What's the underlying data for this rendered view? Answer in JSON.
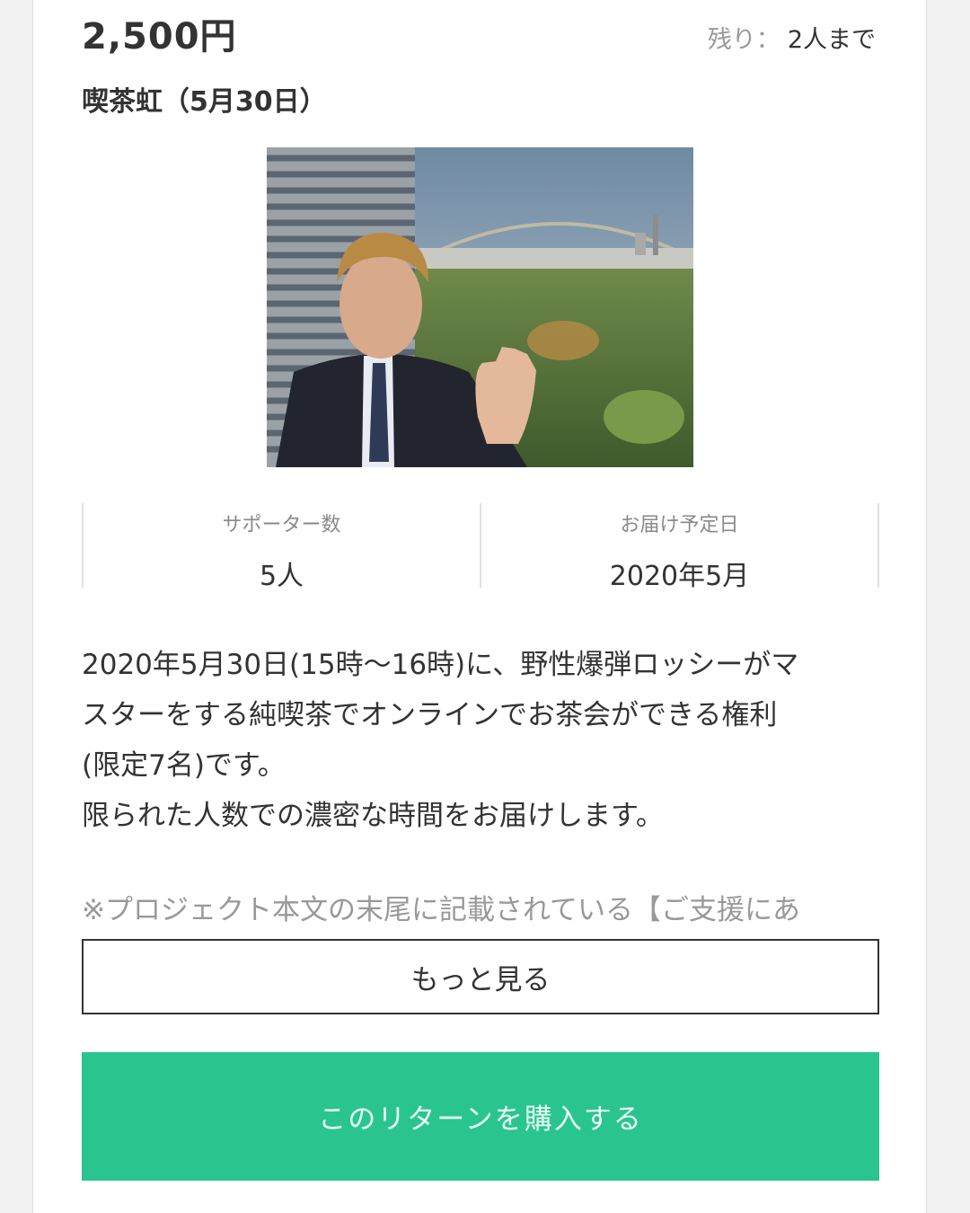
{
  "reward": {
    "price": "2,500円",
    "remaining_label": "残り：",
    "remaining_value": "2人まで",
    "title": "喫茶虹（5月30日）"
  },
  "photo": {
    "icon": "photo-man-rainbow-cityscape"
  },
  "stats": {
    "supporters_label": "サポーター数",
    "supporters_value": "5人",
    "delivery_label": "お届け予定日",
    "delivery_value": "2020年5月"
  },
  "description": {
    "line1": "2020年5月30日(15時〜16時)に、野性爆弾ロッシーがマ",
    "line2": "スターをする純喫茶でオンラインでお茶会ができる権利",
    "line3": "(限定7名)です。",
    "line4": "限られた人数での濃密な時間をお届けします。",
    "note": "※プロジェクト本文の末尾に記載されている【ご支援にあ"
  },
  "buttons": {
    "more_label": "もっと見る",
    "buy_label": "このリターンを購入する"
  },
  "colors": {
    "accent": "#2ac58f",
    "text": "#333333",
    "muted": "#999999"
  }
}
